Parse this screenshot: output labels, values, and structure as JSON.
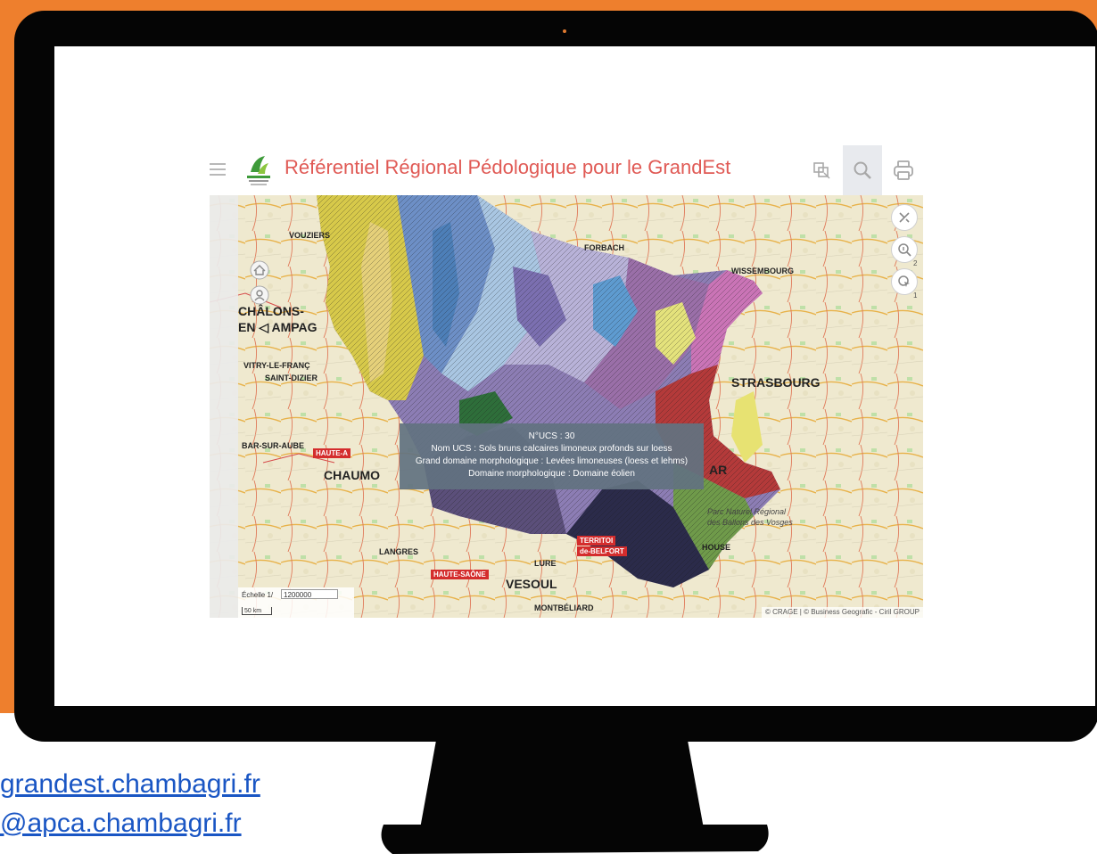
{
  "app": {
    "title": "Référentiel Régional Pédologique pour le GrandEst"
  },
  "header_buttons": [
    {
      "name": "layers-icon"
    },
    {
      "name": "search-icon"
    },
    {
      "name": "print-icon"
    }
  ],
  "map_tools": [
    {
      "name": "measure-tool-icon",
      "badge": ""
    },
    {
      "name": "zoom-info-icon",
      "badge": "2"
    },
    {
      "name": "select-pointer-icon",
      "badge": "1"
    }
  ],
  "popup": {
    "line1": "N°UCS : 30",
    "line2": "Nom UCS : Sols bruns calcaires limoneux profonds sur loess",
    "line3": "Grand domaine morphologique : Levées limoneuses (loess et lehms)",
    "line4": "Domaine morphologique : Domaine éolien"
  },
  "scale": {
    "label": "Échelle 1/",
    "value": "1200000",
    "bar": "50 km"
  },
  "attribution": "© CRAGE | © Business Geografic - Ciril GROUP",
  "places": {
    "chalons": "CHÂLONS-",
    "ampag": "EN ◁ AMPAG",
    "strasbourg": "STRASBOURG",
    "wissembourg": "WISSEMBOURG",
    "chaumont": "CHAUMO",
    "vesoul": "VESOUL",
    "forbach": "FORBACH",
    "langres": "LANGRES",
    "haute_saone": "HAUTE-SAÔNE",
    "territoire": "TERRITOI",
    "belfort": "de-BELFORT",
    "haute_a": "HAUTE-A",
    "bar_sur_aube": "BAR-SUR-AUBE",
    "vitry": "VITRY-LE-FRANÇ",
    "saint_dizier": "SAINT-DIZIER",
    "ar": "AR",
    "house": "HOUSE",
    "montbeliard": "MONTBÉLIARD",
    "ballons1": "Parc Naturel Régional",
    "ballons2": "des Ballons des Vosges",
    "vouziers": "VOUZIERS",
    "lure": "LURE"
  },
  "links": {
    "line1": "grandest.chambagri.fr",
    "line2": "@apca.chambagri.fr"
  },
  "colors": {
    "orange": "#ee7f2d",
    "title_red": "#e05a55",
    "popup_bg": "#627280",
    "link_blue": "#1a56c4"
  }
}
